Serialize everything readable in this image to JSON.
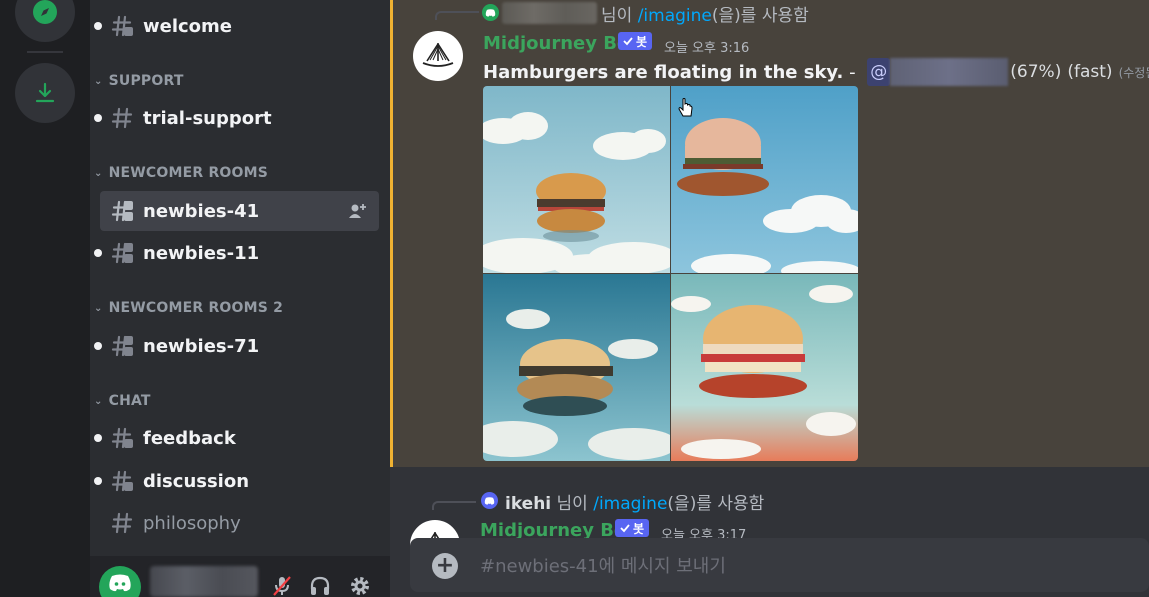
{
  "sidebar": {
    "channels": [
      {
        "label": "welcome"
      },
      {
        "label": "trial-support"
      },
      {
        "label": "newbies-41"
      },
      {
        "label": "newbies-11"
      },
      {
        "label": "newbies-71"
      },
      {
        "label": "feedback"
      },
      {
        "label": "discussion"
      },
      {
        "label": "philosophy"
      }
    ],
    "categories": [
      {
        "label": "SUPPORT"
      },
      {
        "label": "NEWCOMER ROOMS"
      },
      {
        "label": "NEWCOMER ROOMS 2"
      },
      {
        "label": "CHAT"
      }
    ]
  },
  "messages": [
    {
      "reply_suffix": "님이",
      "reply_command": "/imagine",
      "reply_tail": "(을)를 사용함",
      "author": "Midjourney Bot",
      "bot_tag": "봇",
      "timestamp": "오늘 오후 3:16",
      "prompt": "Hamburgers are floating in the sky.",
      "dash": " - ",
      "mention_at": "@",
      "progress": "(67%)",
      "mode": "(fast)",
      "edited": "(수정됨)",
      "progress_value": 67
    },
    {
      "reply_user": "ikehi",
      "reply_suffix": "님이",
      "reply_command": "/imagine",
      "reply_tail": "(을)를 사용함",
      "author": "Midjourney Bot",
      "bot_tag": "봇",
      "timestamp": "오늘 오후 3:17"
    }
  ],
  "composer": {
    "placeholder": "#newbies-41에 메시지 보내기"
  },
  "colors": {
    "accent": "#5865f2",
    "bot_green": "#3ba55d",
    "highlight_border": "#f0b232",
    "command_link": "#00a8fc"
  },
  "icons": [
    "compass-icon",
    "download-icon",
    "hash-icon",
    "hash-thread-icon",
    "add-member-icon",
    "discord-logo-icon",
    "mic-muted-icon",
    "headphones-icon",
    "gear-icon",
    "plus-icon",
    "sailboat-icon",
    "checkmark-icon",
    "pointer-cursor-icon"
  ]
}
